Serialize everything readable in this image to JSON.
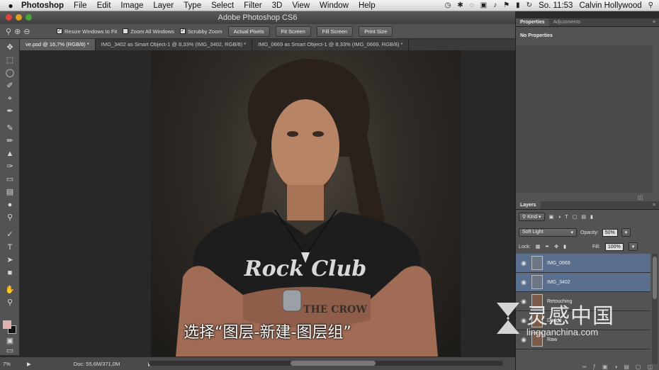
{
  "menubar": {
    "app_name": "Photoshop",
    "items": [
      "File",
      "Edit",
      "Image",
      "Layer",
      "Type",
      "Select",
      "Filter",
      "3D",
      "View",
      "Window",
      "Help"
    ],
    "clock": "So. 11:53",
    "user": "Calvin Hollywood"
  },
  "window": {
    "title": "Adobe Photoshop CS6"
  },
  "options": {
    "resize_windows": "Resize Windows to Fit",
    "zoom_all": "Zoom All Windows",
    "scrubby_zoom": "Scrubby Zoom",
    "actual_pixels": "Actual Pixels",
    "fit_screen": "Fit Screen",
    "fill_screen": "Fill Screen",
    "print_size": "Print Size"
  },
  "doc_tabs": [
    {
      "label": "ve.psd @ 16,7% (RGB/8) *",
      "active": true
    },
    {
      "label": "IMG_3402 as Smart Object-1 @ 8,33% (IMG_3402, RGB/8) *",
      "active": false
    },
    {
      "label": "IMG_0669 as Smart Object-1 @ 8,33% (IMG_0669, RGB/8) *",
      "active": false
    }
  ],
  "canvas": {
    "shirt_text": "Rock Club",
    "tattoo_text": "THE CROW",
    "subtitle": "选择“图层-新建-图层组”"
  },
  "status": {
    "zoom": "7%",
    "doc": "Doc: 55,6M/371,0M"
  },
  "properties_panel": {
    "tabs": [
      "Properties",
      "Adjustments"
    ],
    "body": "No Properties"
  },
  "layers_panel": {
    "tab": "Layers",
    "kind": "Kind",
    "blend_mode": "Soft Light",
    "opacity_label": "Opacity:",
    "opacity": "50%",
    "lock_label": "Lock:",
    "fill_label": "Fill:",
    "fill": "100%",
    "layers": [
      {
        "name": "IMG_0669",
        "active": true
      },
      {
        "name": "IMG_3402",
        "active": true
      },
      {
        "name": "Retouching",
        "active": false
      },
      {
        "name": "Dodge",
        "active": false
      },
      {
        "name": "Raw",
        "active": false
      }
    ]
  },
  "watermark": {
    "cn": "灵感中国",
    "en": "lingganchina.com"
  },
  "colors": {
    "fg": "#e6b1b1",
    "bg": "#111111",
    "selection": "#5a6f8e"
  }
}
